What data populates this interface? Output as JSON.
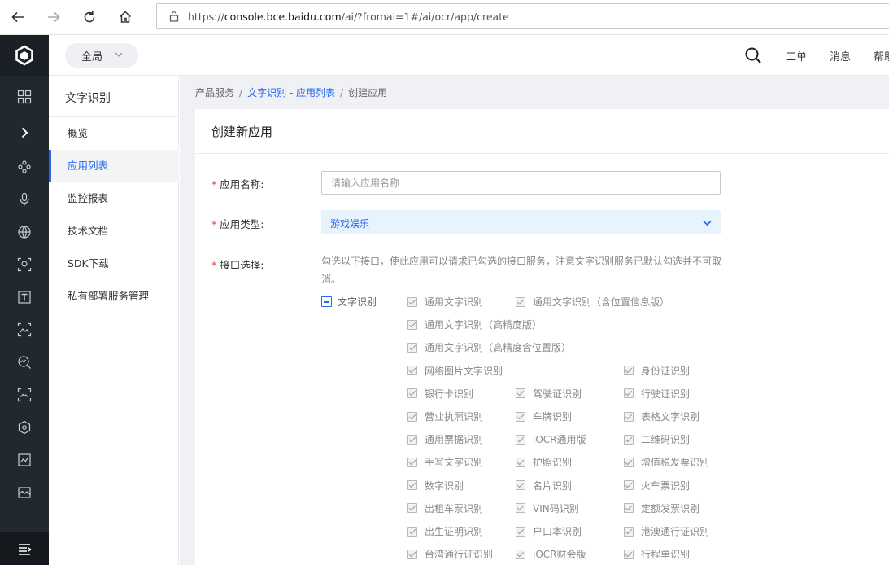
{
  "browser": {
    "url_prefix": "https://",
    "url_host": "console.bce.baidu.com",
    "url_path": "/ai/?fromai=1#/ai/ocr/app/create"
  },
  "header": {
    "scope_label": "全局",
    "links": [
      "工单",
      "消息",
      "帮助"
    ]
  },
  "sidebar": {
    "title": "文字识别",
    "items": [
      {
        "label": "概览",
        "active": false
      },
      {
        "label": "应用列表",
        "active": true
      },
      {
        "label": "监控报表",
        "active": false
      },
      {
        "label": "技术文档",
        "active": false
      },
      {
        "label": "SDK下载",
        "active": false
      },
      {
        "label": "私有部署服务管理",
        "active": false
      }
    ]
  },
  "breadcrumb": {
    "root": "产品服务",
    "link": "文字识别 - 应用列表",
    "current": "创建应用",
    "separator": "/"
  },
  "form": {
    "title": "创建新应用",
    "required_mark": "*",
    "name_label": "应用名称:",
    "name_placeholder": "请输入应用名称",
    "type_label": "应用类型:",
    "type_value": "游戏娱乐",
    "api_label": "接口选择:",
    "api_hint": "勾选以下接口，使此应用可以请求已勾选的接口服务，注意文字识别服务已默认勾选并不可取消。",
    "group_label": "文字识别",
    "apis": [
      "通用文字识别",
      "通用文字识别（含位置信息版）",
      "通用文字识别（高精度版）",
      "通用文字识别（高精度含位置版）",
      "网络图片文字识别",
      "身份证识别",
      "银行卡识别",
      "驾驶证识别",
      "行驶证识别",
      "营业执照识别",
      "车牌识别",
      "表格文字识别",
      "通用票据识别",
      "iOCR通用版",
      "二维码识别",
      "手写文字识别",
      "护照识别",
      "增值税发票识别",
      "数字识别",
      "名片识别",
      "火车票识别",
      "出租车票识别",
      "VIN码识别",
      "定额发票识别",
      "出生证明识别",
      "户口本识别",
      "港澳通行证识别",
      "台湾通行证识别",
      "iOCR财会版",
      "行程单识别"
    ]
  },
  "colors": {
    "accent": "#2468f2",
    "rail": "#222830",
    "required": "#e5413a"
  }
}
